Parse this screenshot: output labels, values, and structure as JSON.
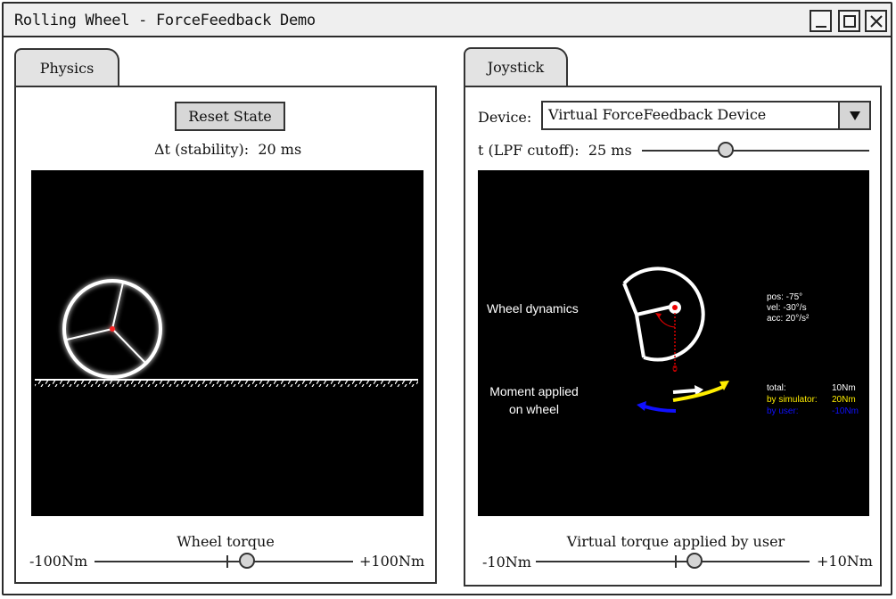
{
  "window": {
    "title": "Rolling Wheel - ForceFeedback Demo"
  },
  "physics": {
    "tab_label": "Physics",
    "reset_label": "Reset State",
    "dt_label": "Δt (stability):",
    "dt_value": "20 ms",
    "torque_title": "Wheel torque",
    "torque_min": "-100Nm",
    "torque_max": "+100Nm",
    "torque_slider_fraction": 0.59
  },
  "joystick": {
    "tab_label": "Joystick",
    "device_label": "Device:",
    "device_value": "Virtual ForceFeedback Device",
    "lpf_label": "t (LPF cutoff):",
    "lpf_value": "25 ms",
    "lpf_slider_fraction": 0.37,
    "torque_title": "Virtual torque applied by user",
    "torque_min": "-10Nm",
    "torque_max": "+10Nm",
    "torque_slider_fraction": 0.58,
    "viz": {
      "wheel_dynamics_label": "Wheel dynamics",
      "moment_label_line1": "Moment applied",
      "moment_label_line2": "on wheel",
      "pos": "pos: -75°",
      "vel": "vel:  -30°/s",
      "acc": "acc:  20°/s²",
      "zero_mark": "0",
      "total_label": "total:",
      "total_value": "10Nm",
      "sim_label": "by simulator:",
      "sim_value": "20Nm",
      "user_label": "by user:",
      "user_value": "-10Nm",
      "colors": {
        "total": "#ffffff",
        "simulator": "#ffee00",
        "user": "#1010ff"
      }
    }
  }
}
